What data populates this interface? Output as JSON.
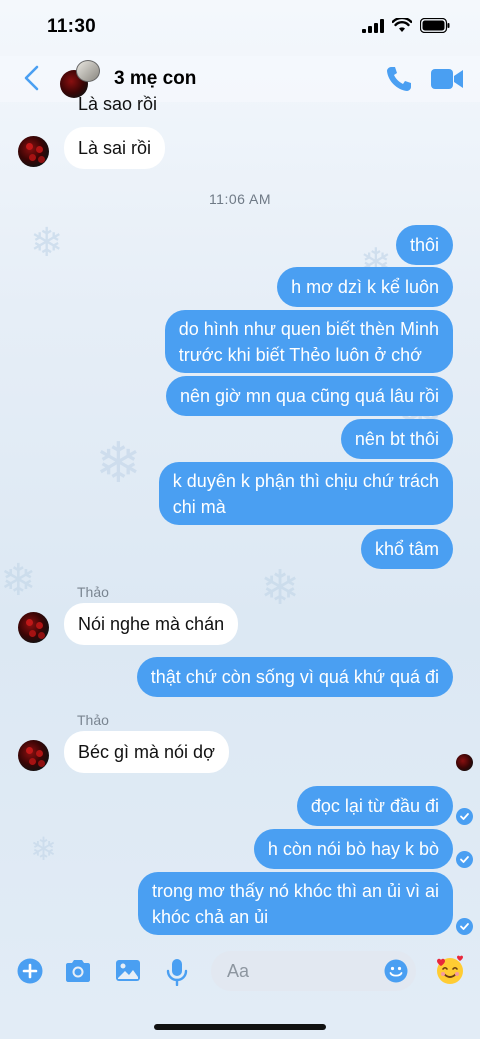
{
  "status": {
    "time": "11:30"
  },
  "header": {
    "title": "3 mẹ con"
  },
  "timestamp": "11:06 AM",
  "messages": [
    {
      "dir": "in",
      "text": "Là sao rồi"
    },
    {
      "dir": "in",
      "text": "Là sai rồi"
    },
    {
      "dir": "out",
      "text": "thôi"
    },
    {
      "dir": "out",
      "text": "h mơ dzì k kể luôn"
    },
    {
      "dir": "out",
      "lines": [
        "do hình như quen biết thèn Minh",
        "trước khi biết Thẻo luôn ở chớ"
      ]
    },
    {
      "dir": "out",
      "text": "nên giờ mn qua cũng quá lâu rồi"
    },
    {
      "dir": "out",
      "text": "nên bt thôi"
    },
    {
      "dir": "out",
      "lines": [
        "k duyên k phận thì chịu chứ trách",
        "chi mà"
      ]
    },
    {
      "dir": "out",
      "text": "khổ tâm"
    },
    {
      "dir": "in",
      "sender": "Thảo",
      "text": "Nói nghe mà chán"
    },
    {
      "dir": "out",
      "text": "thật chứ còn sống vì quá khứ quá đi"
    },
    {
      "dir": "in",
      "sender": "Thảo",
      "text": "Béc gì mà nói dợ"
    },
    {
      "dir": "out",
      "text": "đọc lại từ đầu đi"
    },
    {
      "dir": "out",
      "text": "h còn nói bò hay k bò"
    },
    {
      "dir": "out",
      "lines": [
        "trong mơ thấy nó khóc thì an ủi vì ai",
        "khóc chả an ủi"
      ]
    }
  ],
  "composer": {
    "placeholder": "Aa"
  },
  "colors": {
    "accent": "#4a9ff2",
    "incoming_bubble": "#ffffff"
  },
  "icons": [
    "back-chevron",
    "phone",
    "video-camera",
    "plus",
    "camera",
    "image",
    "microphone",
    "smiley",
    "smiling-face-with-hearts"
  ]
}
